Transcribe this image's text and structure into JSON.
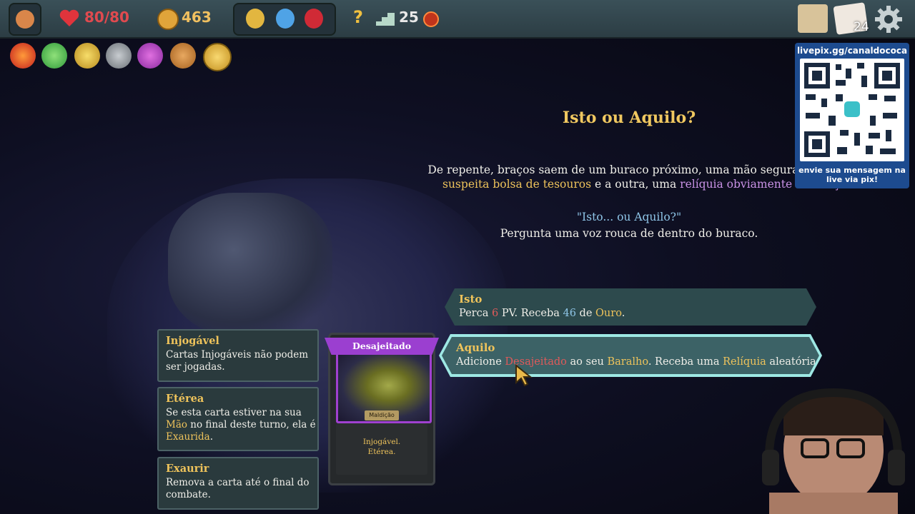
{
  "hud": {
    "health": "80/80",
    "gold": "463",
    "floor": "25",
    "deck_count": "24"
  },
  "hud_icons": [
    "bag-icon",
    "heart-icon",
    "gold-coin-icon",
    "lightning-potion-icon",
    "blue-potion-icon",
    "red-potion-icon",
    "help-icon",
    "floor-stairs-icon",
    "red-gem-icon",
    "map-icon",
    "deck-icon",
    "gear-icon"
  ],
  "relics": [
    "burning-blood-icon",
    "green-leaf-icon",
    "golden-staff-icon",
    "stone-icon",
    "fan-icon",
    "claw-icon",
    "pocketwatch-icon"
  ],
  "event": {
    "title": "Isto ou Aquilo?",
    "line1": "De repente, braços saem de um buraco próximo, uma mão segurando u",
    "line2_a": "suspeita bolsa de tesouros",
    "line2_b": " e a outra, uma ",
    "line2_c": "relíquia obviamente amaldiço",
    "quote": "\"Isto... ou Aquilo?\"",
    "quote_sub": "Pergunta uma voz rouca de dentro do buraco."
  },
  "options": [
    {
      "title": "Isto",
      "desc_parts": [
        "Perca ",
        "6",
        " PV. Receba ",
        "46",
        " de ",
        "Ouro",
        "."
      ]
    },
    {
      "title": "Aquilo",
      "desc_parts": [
        "Adicione ",
        "Desajeitado",
        " ao seu ",
        "Baralho",
        ". Receba uma ",
        "Relíquia",
        " aleatória."
      ]
    }
  ],
  "tooltips": [
    {
      "title": "Injogável",
      "body": "Cartas Injogáveis não podem ser jogadas."
    },
    {
      "title": "Etérea",
      "body_a": "Se esta carta estiver na sua ",
      "body_b": "Mão",
      "body_c": " no final deste turno, ela é ",
      "body_d": "Exaurida",
      "body_e": "."
    },
    {
      "title": "Exaurir",
      "body": "Remova a carta até o final do combate."
    }
  ],
  "card": {
    "name": "Desajeitado",
    "type": "Maldição",
    "text1": "Injogável.",
    "text2": "Etérea."
  },
  "stream": {
    "qr_url": "livepix.gg/canaldococa",
    "qr_message": "envie sua mensagem na live via pix!"
  },
  "colors": {
    "keyword_gold": "#eec35b",
    "keyword_purple": "#c992e6",
    "keyword_blue": "#8fc6e8",
    "keyword_red": "#e05a5a",
    "option_bg": "#2d4a4d",
    "option_highlight": "#9ee8e4",
    "curse_purple": "#9b3fd0"
  }
}
